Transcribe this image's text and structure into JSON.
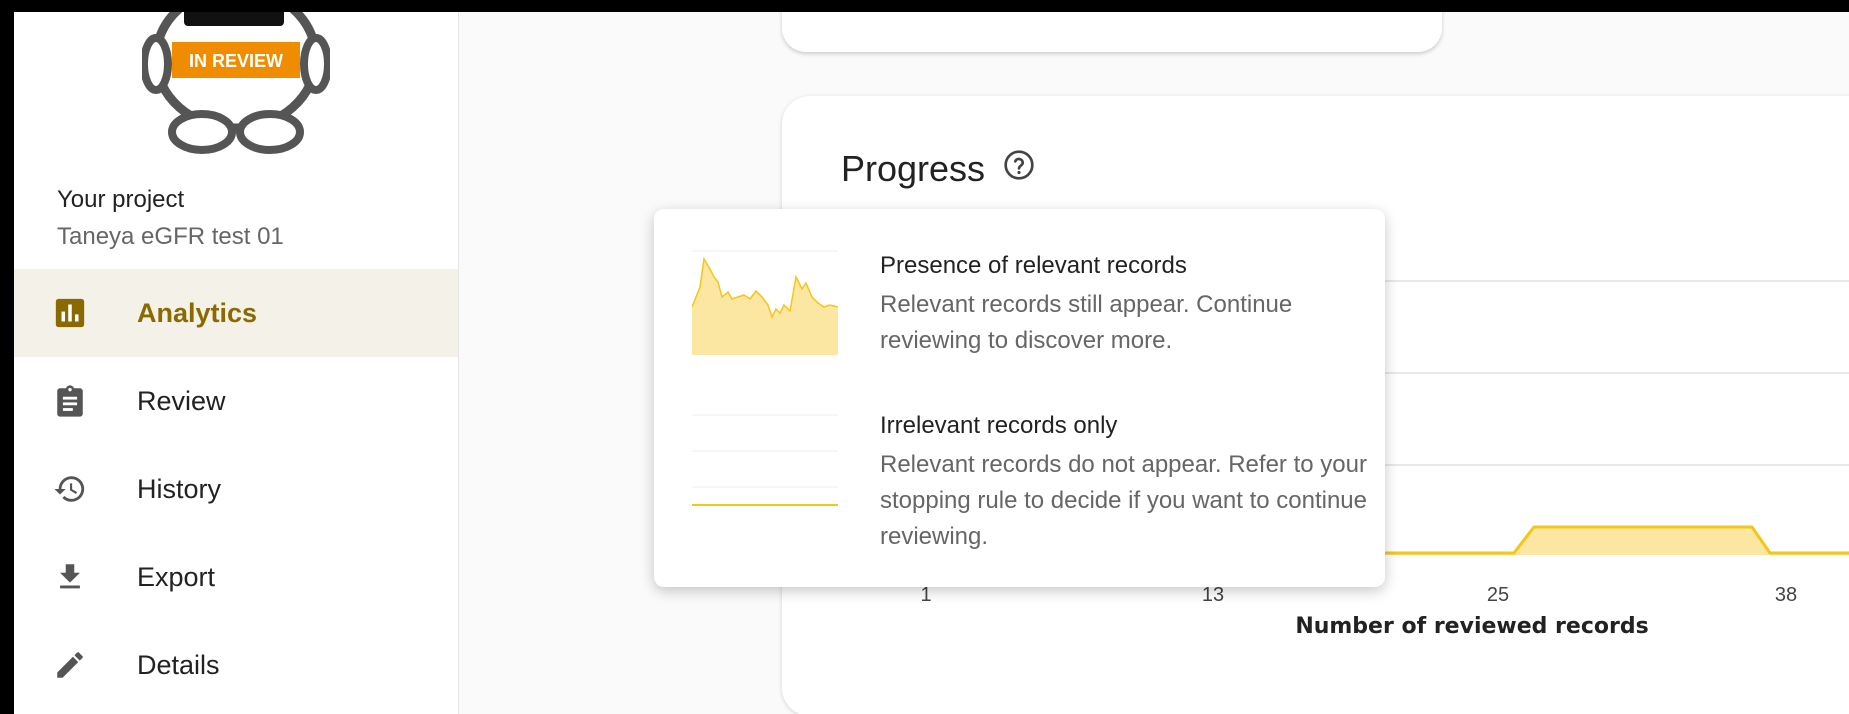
{
  "sidebar": {
    "badge": "IN REVIEW",
    "project_heading": "Your project",
    "project_name": "Taneya eGFR test 01",
    "items": [
      {
        "label": "Analytics",
        "icon": "bar-chart-icon",
        "active": true
      },
      {
        "label": "Review",
        "icon": "clipboard-icon",
        "active": false
      },
      {
        "label": "History",
        "icon": "history-icon",
        "active": false
      },
      {
        "label": "Export",
        "icon": "download-icon",
        "active": false
      },
      {
        "label": "Details",
        "icon": "pencil-icon",
        "active": false
      }
    ]
  },
  "progress": {
    "title": "Progress",
    "help_icon": "help-circle-icon",
    "x_ticks": [
      "1",
      "13",
      "25",
      "38"
    ],
    "x_label": "Number of reviewed records"
  },
  "tooltip": {
    "items": [
      {
        "title": "Presence of relevant records",
        "text": "Relevant records still appear. Continue reviewing to discover more."
      },
      {
        "title": "Irrelevant records only",
        "text": "Relevant records do not appear. Refer to your stopping rule to decide if you want to continue reviewing."
      }
    ]
  },
  "colors": {
    "accent": "#f5c518",
    "accent_fill": "#fbe7a1",
    "active_text": "#8a6a00",
    "active_bg": "#f4f1e8",
    "badge": "#f08c00"
  }
}
